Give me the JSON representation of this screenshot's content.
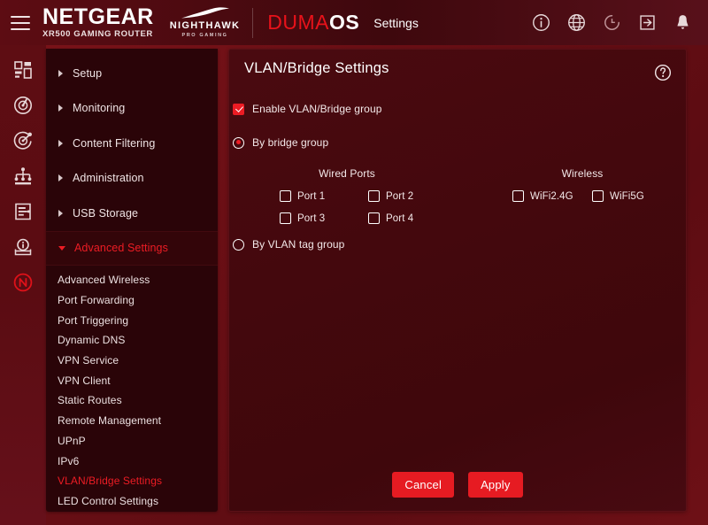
{
  "header": {
    "menu_icon": "hamburger-icon",
    "brand": "NETGEAR",
    "model": "XR500 GAMING ROUTER",
    "nighthawk": "NIGHTHAWK",
    "nighthawk_sub": "PRO GAMING",
    "duma_part1": "DUMA",
    "duma_part2": "OS",
    "settings_label": "Settings",
    "icons": [
      {
        "name": "info-icon"
      },
      {
        "name": "globe-icon"
      },
      {
        "name": "reboot-icon"
      },
      {
        "name": "logout-icon"
      },
      {
        "name": "notification-bell-icon"
      }
    ]
  },
  "rail": {
    "items": [
      {
        "name": "dashboard-icon"
      },
      {
        "name": "speedometer-icon"
      },
      {
        "name": "geo-filter-icon"
      },
      {
        "name": "network-map-icon"
      },
      {
        "name": "traffic-controller-icon"
      },
      {
        "name": "device-manager-icon"
      },
      {
        "name": "netduma-logo-icon"
      }
    ]
  },
  "sidebar": {
    "menu": [
      {
        "label": "Setup",
        "expanded": false
      },
      {
        "label": "Monitoring",
        "expanded": false
      },
      {
        "label": "Content Filtering",
        "expanded": false
      },
      {
        "label": "Administration",
        "expanded": false
      },
      {
        "label": "USB Storage",
        "expanded": false
      },
      {
        "label": "Advanced Settings",
        "expanded": true
      }
    ],
    "submenu": [
      {
        "label": "Advanced Wireless",
        "selected": false
      },
      {
        "label": "Port Forwarding",
        "selected": false
      },
      {
        "label": "Port Triggering",
        "selected": false
      },
      {
        "label": "Dynamic DNS",
        "selected": false
      },
      {
        "label": "VPN Service",
        "selected": false
      },
      {
        "label": "VPN Client",
        "selected": false
      },
      {
        "label": "Static Routes",
        "selected": false
      },
      {
        "label": "Remote Management",
        "selected": false
      },
      {
        "label": "UPnP",
        "selected": false
      },
      {
        "label": "IPv6",
        "selected": false
      },
      {
        "label": "VLAN/Bridge Settings",
        "selected": true
      },
      {
        "label": "LED Control Settings",
        "selected": false
      }
    ]
  },
  "content": {
    "title": "VLAN/Bridge Settings",
    "help_icon": "help-circle-icon",
    "enable_checkbox": {
      "label": "Enable VLAN/Bridge group",
      "checked": true
    },
    "mode_bridge": {
      "label": "By bridge group",
      "selected": true
    },
    "mode_vlan_tag": {
      "label": "By VLAN tag group",
      "selected": false
    },
    "wired": {
      "title": "Wired Ports",
      "ports": [
        {
          "label": "Port 1",
          "checked": false
        },
        {
          "label": "Port 2",
          "checked": false
        },
        {
          "label": "Port 3",
          "checked": false
        },
        {
          "label": "Port 4",
          "checked": false
        }
      ]
    },
    "wireless": {
      "title": "Wireless",
      "bands": [
        {
          "label": "WiFi2.4G",
          "checked": false
        },
        {
          "label": "WiFi5G",
          "checked": false
        }
      ]
    },
    "buttons": {
      "cancel": "Cancel",
      "apply": "Apply"
    }
  },
  "colors": {
    "accent_red": "#ed1c24",
    "button_red": "#e61b22",
    "sidebar_bg": "#2a0408",
    "content_bg": "#45090e",
    "page_bg": "#6e1016",
    "text": "#f2e6e7"
  }
}
